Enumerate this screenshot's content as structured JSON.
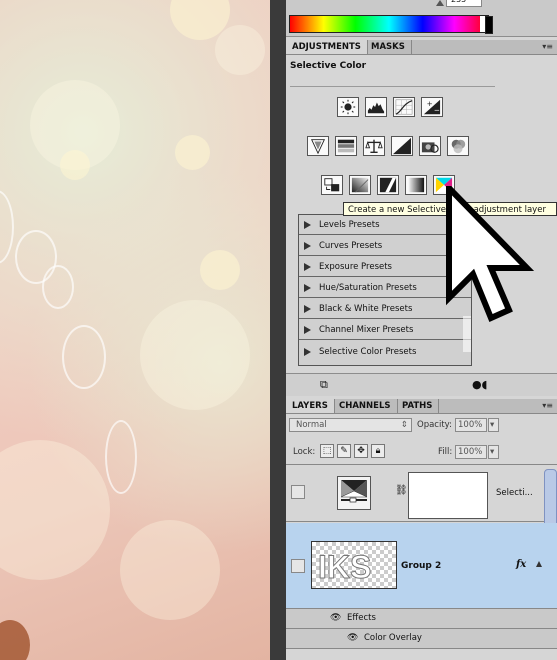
{
  "color_picker": {
    "value_text": "255"
  },
  "adjustments_panel": {
    "tabs": [
      "ADJUSTMENTS",
      "MASKS"
    ],
    "active_tab": "ADJUSTMENTS",
    "subtitle": "Selective Color",
    "icons_row1": [
      "brightness-contrast-icon",
      "levels-icon",
      "curves-icon",
      "exposure-icon"
    ],
    "icons_row2": [
      "vibrance-icon",
      "hue-saturation-icon",
      "color-balance-icon",
      "black-white-icon",
      "photo-filter-icon",
      "channel-mixer-icon"
    ],
    "icons_row3": [
      "invert-icon",
      "posterize-icon",
      "threshold-icon",
      "gradient-map-icon",
      "selective-color-icon"
    ],
    "tooltip": "Create a new Selective Color adjustment layer",
    "presets": [
      "Levels Presets",
      "Curves Presets",
      "Exposure Presets",
      "Hue/Saturation Presets",
      "Black & White Presets",
      "Channel Mixer Presets",
      "Selective Color Presets"
    ]
  },
  "layers_panel": {
    "tabs": [
      "LAYERS",
      "CHANNELS",
      "PATHS"
    ],
    "active_tab": "LAYERS",
    "blend_mode": "Normal",
    "opacity_label": "Opacity:",
    "opacity_value": "100%",
    "lock_label": "Lock:",
    "fill_label": "Fill:",
    "fill_value": "100%",
    "layers": [
      {
        "name": "Selecti...",
        "selected": false
      },
      {
        "name": "Group 2",
        "selected": true,
        "fx": "fx"
      }
    ],
    "effects_label": "Effects",
    "effect_items": [
      "Color Overlay"
    ]
  }
}
